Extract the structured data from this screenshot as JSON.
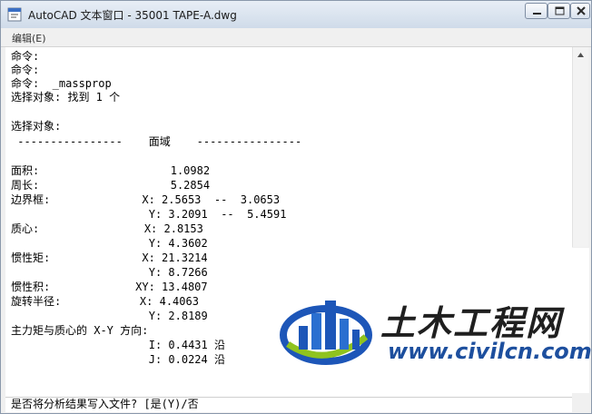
{
  "window": {
    "title": "AutoCAD 文本窗口 - 35001 TAPE-A.dwg",
    "controls": [
      "minimize",
      "maximize",
      "close"
    ]
  },
  "menu": {
    "items": [
      {
        "label": "编辑(E)"
      }
    ]
  },
  "console": {
    "lines": [
      "命令:",
      "命令:",
      "命令:  _massprop",
      "选择对象: 找到 1 个",
      "",
      "选择对象:",
      " ----------------    面域    ----------------",
      "",
      "面积:                    1.0982",
      "周长:                    5.2854",
      "边界框:              X: 2.5653  --  3.0653",
      "                     Y: 3.2091  --  5.4591",
      "质心:                X: 2.8153",
      "                     Y: 4.3602",
      "惯性矩:              X: 21.3214",
      "                     Y: 8.7266",
      "惯性积:             XY: 13.4807",
      "旋转半径:            X: 4.4063",
      "                     Y: 2.8189",
      "主力矩与质心的 X-Y 方向:",
      "                     I: 0.4431 沿",
      "                     J: 0.0224 沿"
    ],
    "prompt": "是否将分析结果写入文件? [是(Y)/否"
  },
  "watermark": {
    "name": "土木工程网",
    "url": "www.civilcn.com",
    "colors": {
      "blue": "#1d56b8",
      "green": "#8fc31f",
      "dark": "#1f1f1f"
    }
  },
  "icons": [
    "autocad-app-icon",
    "minimize-icon",
    "maximize-icon",
    "close-icon",
    "scroll-up-arrow-icon",
    "civilcn-logo-icon"
  ]
}
